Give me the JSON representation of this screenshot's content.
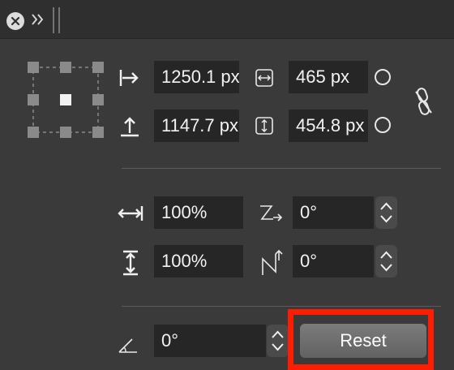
{
  "toolbar": {
    "close_icon": "close-icon",
    "expand_icon": "double-chevron-right-icon",
    "grip_icon": "drag-grip-icon"
  },
  "position": {
    "x_value": "1250.1 px",
    "y_value": "1147.7 px"
  },
  "size": {
    "width_value": "465 px",
    "height_value": "454.8 px"
  },
  "scale": {
    "horizontal_value": "100%",
    "vertical_value": "100%"
  },
  "shear": {
    "horizontal_value": "0°",
    "vertical_value": "0°"
  },
  "rotation": {
    "value": "0°"
  },
  "actions": {
    "reset_label": "Reset"
  },
  "colors": {
    "panel_bg": "#3a3a3a",
    "field_bg": "#262626",
    "highlight": "#ff1d00"
  }
}
